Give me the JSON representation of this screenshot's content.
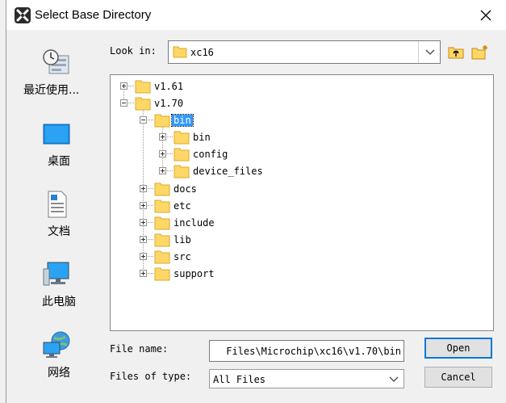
{
  "dialog": {
    "title": "Select Base Directory",
    "close_label": "✕"
  },
  "places": [
    {
      "label": "最近使用...",
      "icon": "recent-places-icon"
    },
    {
      "label": "桌面",
      "icon": "desktop-icon"
    },
    {
      "label": "文档",
      "icon": "documents-icon"
    },
    {
      "label": "此电脑",
      "icon": "this-pc-icon"
    },
    {
      "label": "网络",
      "icon": "network-icon"
    }
  ],
  "look_in": {
    "label": "Look in:",
    "value": "xc16",
    "up_folder_icon": "up-one-level-icon",
    "new_folder_icon": "new-folder-icon"
  },
  "tree": {
    "nodes": [
      {
        "name": "v1.61",
        "expander": "plus"
      },
      {
        "name": "v1.70",
        "expander": "minus"
      },
      {
        "name": "bin",
        "expander": "minus",
        "selected": true
      },
      {
        "name": "bin",
        "expander": "plus"
      },
      {
        "name": "config",
        "expander": "plus"
      },
      {
        "name": "device_files",
        "expander": "plus"
      },
      {
        "name": "docs",
        "expander": "plus"
      },
      {
        "name": "etc",
        "expander": "plus"
      },
      {
        "name": "include",
        "expander": "plus"
      },
      {
        "name": "lib",
        "expander": "plus"
      },
      {
        "name": "src",
        "expander": "plus"
      },
      {
        "name": "support",
        "expander": "plus"
      }
    ]
  },
  "file_name": {
    "label": "File name:",
    "value": "Files\\Microchip\\xc16\\v1.70\\bin"
  },
  "file_type": {
    "label": "Files of type:",
    "value": "All Files"
  },
  "buttons": {
    "open": "Open",
    "cancel": "Cancel"
  },
  "colors": {
    "selection": "#3399ff",
    "default_button_border": "#0078d7",
    "folder_fill": "#ffd766"
  }
}
